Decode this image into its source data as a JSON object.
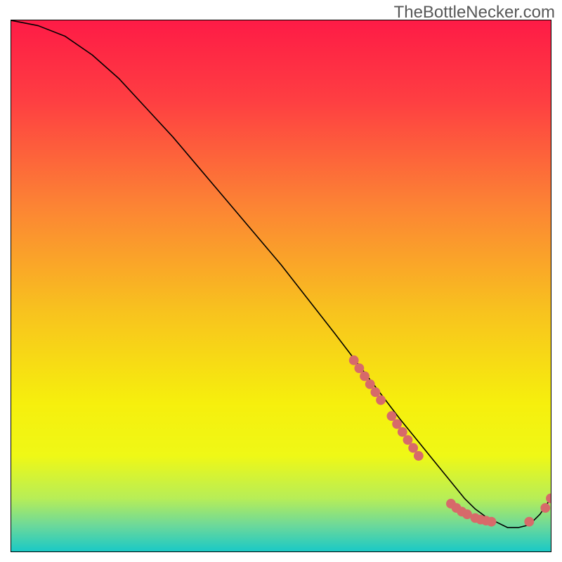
{
  "watermark": "TheBottleNecker.com",
  "chart_data": {
    "type": "line",
    "title": "",
    "xlabel": "",
    "ylabel": "",
    "xlim": [
      0,
      100
    ],
    "ylim": [
      0,
      100
    ],
    "grid": false,
    "legend": false,
    "background": "vertical rainbow gradient red→yellow→green",
    "series": [
      {
        "name": "curve",
        "x": [
          0,
          5,
          10,
          15,
          20,
          25,
          30,
          35,
          40,
          45,
          50,
          55,
          60,
          63,
          66,
          69,
          72,
          74,
          76,
          78,
          80,
          82,
          84,
          86,
          88,
          90,
          92,
          94,
          96,
          98,
          100
        ],
        "y": [
          100,
          99,
          97,
          93.5,
          89,
          83.5,
          78,
          72,
          66,
          60,
          54,
          47.5,
          41,
          37,
          33,
          29,
          25,
          22.5,
          20,
          17.5,
          15,
          12.5,
          10,
          8,
          6.5,
          5.5,
          4.5,
          4.5,
          5,
          7,
          10
        ]
      }
    ],
    "markers": [
      {
        "x": 63.5,
        "y": 36
      },
      {
        "x": 64.5,
        "y": 34.5
      },
      {
        "x": 65.5,
        "y": 33
      },
      {
        "x": 66.5,
        "y": 31.5
      },
      {
        "x": 67.5,
        "y": 30
      },
      {
        "x": 68.5,
        "y": 28.5
      },
      {
        "x": 70.5,
        "y": 25.5
      },
      {
        "x": 71.5,
        "y": 24
      },
      {
        "x": 72.5,
        "y": 22.5
      },
      {
        "x": 73.5,
        "y": 21
      },
      {
        "x": 74.5,
        "y": 19.5
      },
      {
        "x": 75.5,
        "y": 18
      },
      {
        "x": 81.5,
        "y": 9
      },
      {
        "x": 82.5,
        "y": 8.2
      },
      {
        "x": 83.5,
        "y": 7.5
      },
      {
        "x": 84.5,
        "y": 7.0
      },
      {
        "x": 86.0,
        "y": 6.3
      },
      {
        "x": 87.0,
        "y": 6.0
      },
      {
        "x": 88.0,
        "y": 5.8
      },
      {
        "x": 89.0,
        "y": 5.6
      },
      {
        "x": 96.0,
        "y": 5.6
      },
      {
        "x": 99.0,
        "y": 8.2
      },
      {
        "x": 100.0,
        "y": 10
      }
    ],
    "marker_color": "#d76a6a",
    "marker_radius_data_x": 0.9
  }
}
